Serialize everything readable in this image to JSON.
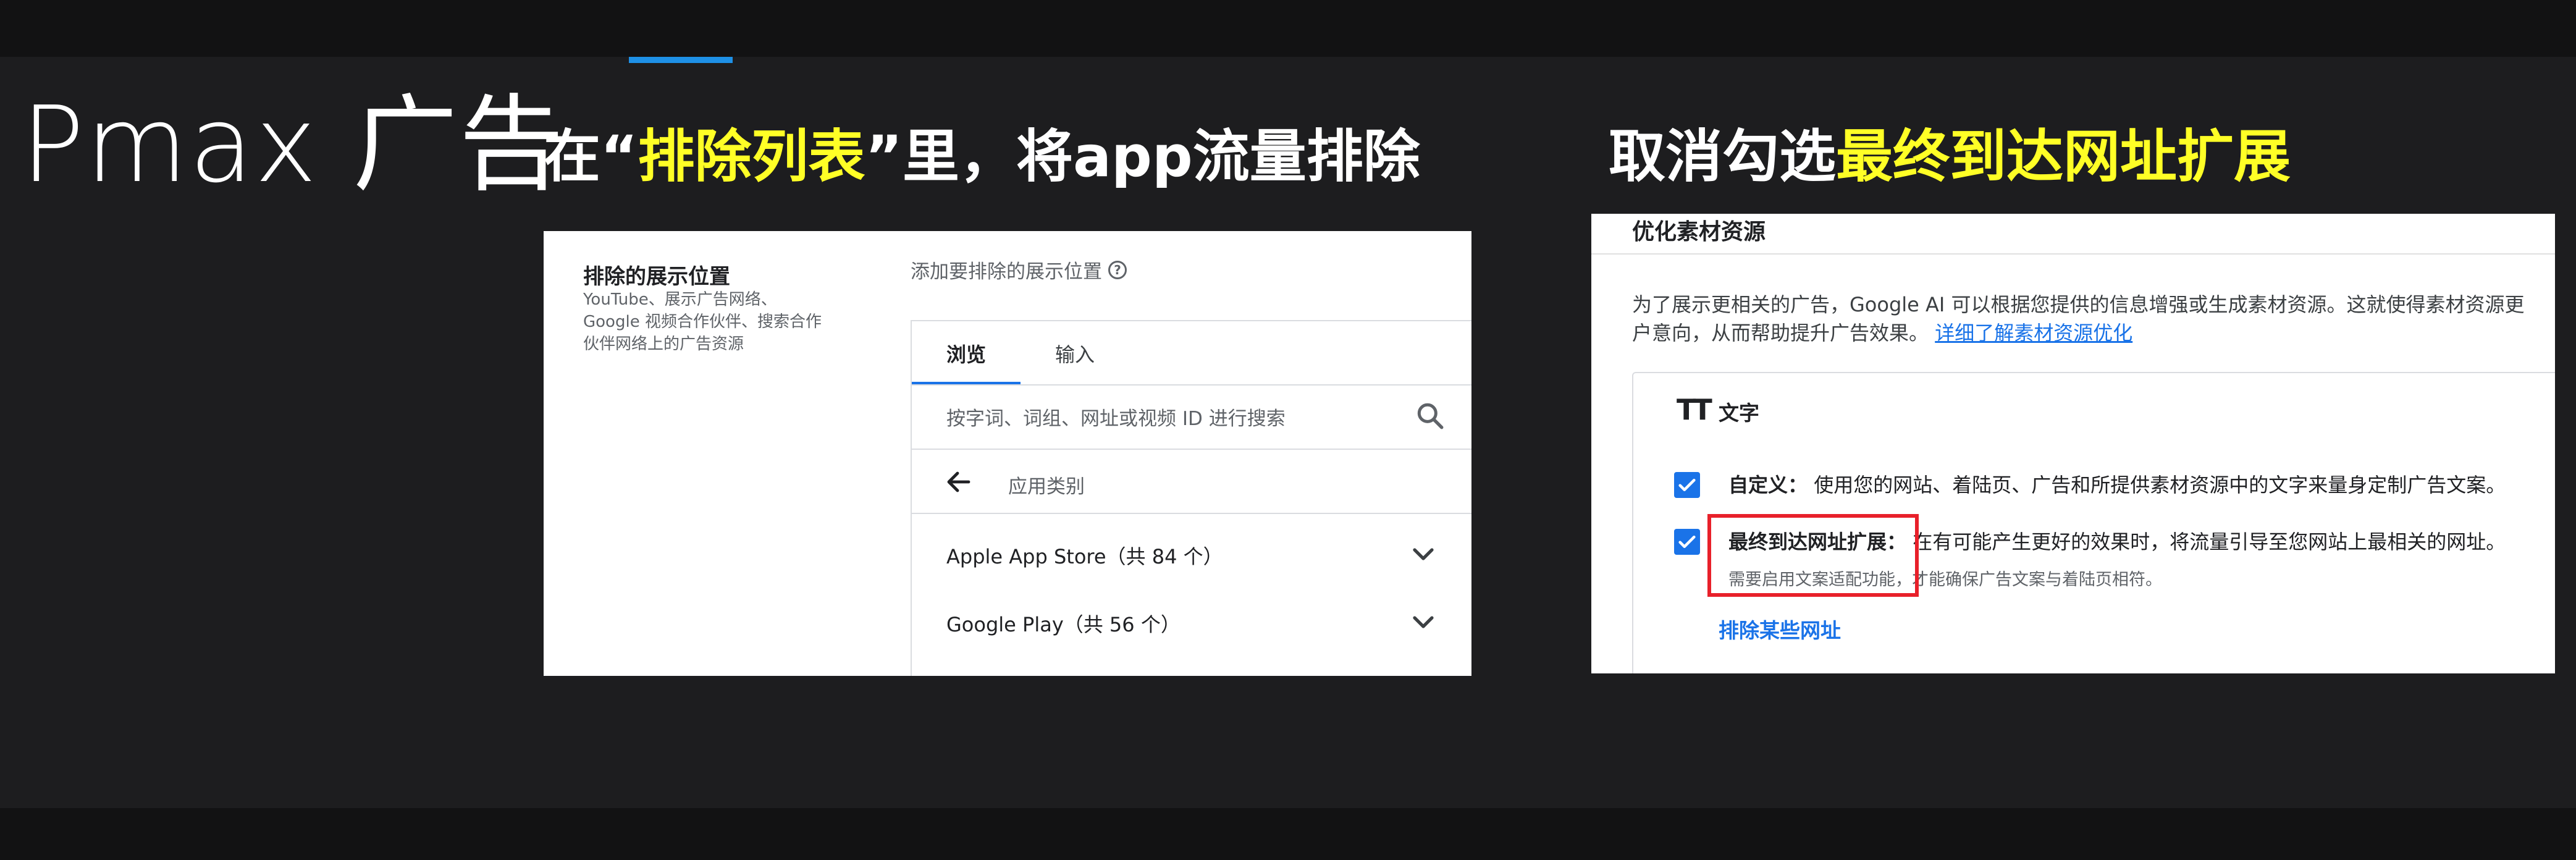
{
  "slide": {
    "title": "Pmax 广告",
    "step1": {
      "prefix": "在“",
      "highlight": "排除列表",
      "suffix": "”里，将app流量排除"
    },
    "step2": {
      "prefix": "取消勾选",
      "highlight": "最终到达网址扩展"
    }
  },
  "panel1": {
    "left_title": "排除的展示位置",
    "left_description": "YouTube、展示广告网络、Google 视频合作伙伴、搜索合作伙伴网络上的广告资源",
    "add_label": "添加要排除的展示位置",
    "help_icon": "help-circle-icon",
    "tabs": [
      "浏览",
      "输入"
    ],
    "active_tab": "浏览",
    "search_placeholder": "按字词、词组、网址或视频 ID 进行搜索",
    "search_icon": "search-icon",
    "back_icon": "arrow-left-icon",
    "category": "应用类别",
    "stores": [
      {
        "label": "Apple App Store（共 84 个）",
        "icon": "chevron-down-icon"
      },
      {
        "label": "Google Play（共 56 个）",
        "icon": "chevron-down-icon"
      }
    ]
  },
  "panel2": {
    "header": "优化素材资源",
    "desc_line1": "为了展示更相关的广告，Google AI 可以根据您提供的信息增强或生成素材资源。这就使得素材资源更",
    "desc_line2": "户意向，从而帮助提升广告效果。",
    "desc_link": "详细了解素材资源优化",
    "section_icon": "text-format-icon",
    "section_icon_glyph": "TT",
    "section_label": "文字",
    "options": [
      {
        "label": "自定义：",
        "text": "使用您的网站、着陆页、广告和所提供素材资源中的文字来量身定制广告文案。",
        "checked": true
      },
      {
        "label": "最终到达网址扩展：",
        "text": "在有可能产生更好的效果时，将流量引导至您网站上最相关的网址。",
        "checked": true,
        "note": "需要启用文案适配功能，才能确保广告文案与着陆页相符。"
      }
    ],
    "exclude_link": "排除某些网址"
  },
  "colors": {
    "background": "#1d1d1f",
    "highlight": "#ffff26",
    "accent_blue": "#1e90e6",
    "link_blue": "#1a73e8",
    "red_box": "#e8202a"
  }
}
